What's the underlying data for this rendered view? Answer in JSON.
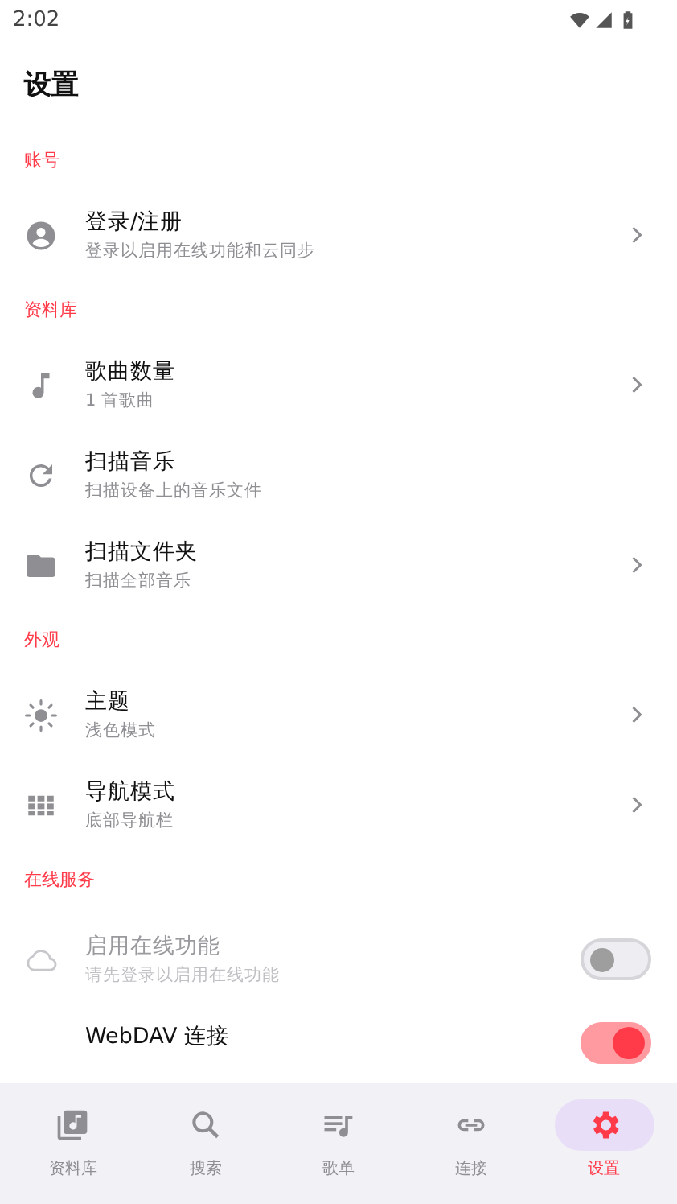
{
  "status_bar": {
    "time": "2:02"
  },
  "header": {
    "title": "设置"
  },
  "sections": [
    {
      "title": "账号",
      "items": [
        {
          "kind": "nav",
          "title": "登录/注册",
          "subtitle": "登录以启用在线功能和云同步",
          "disabled": false
        }
      ]
    },
    {
      "title": "资料库",
      "items": [
        {
          "kind": "nav",
          "title": "歌曲数量",
          "subtitle": "1 首歌曲",
          "disabled": false
        },
        {
          "kind": "action",
          "title": "扫描音乐",
          "subtitle": "扫描设备上的音乐文件",
          "disabled": false
        },
        {
          "kind": "nav",
          "title": "扫描文件夹",
          "subtitle": "扫描全部音乐",
          "disabled": false
        }
      ]
    },
    {
      "title": "外观",
      "items": [
        {
          "kind": "nav",
          "title": "主题",
          "subtitle": "浅色模式",
          "disabled": false
        },
        {
          "kind": "nav",
          "title": "导航模式",
          "subtitle": "底部导航栏",
          "disabled": false
        }
      ]
    },
    {
      "title": "在线服务",
      "items": [
        {
          "kind": "toggle",
          "title": "启用在线功能",
          "subtitle": "请先登录以启用在线功能",
          "disabled": true,
          "on": false
        },
        {
          "kind": "toggle",
          "title": "WebDAV 连接",
          "disabled": false,
          "on": true
        }
      ]
    }
  ],
  "bottom_nav": [
    {
      "label": "资料库",
      "selected": false
    },
    {
      "label": "搜索",
      "selected": false
    },
    {
      "label": "歌单",
      "selected": false
    },
    {
      "label": "连接",
      "selected": false
    },
    {
      "label": "设置",
      "selected": true
    }
  ]
}
